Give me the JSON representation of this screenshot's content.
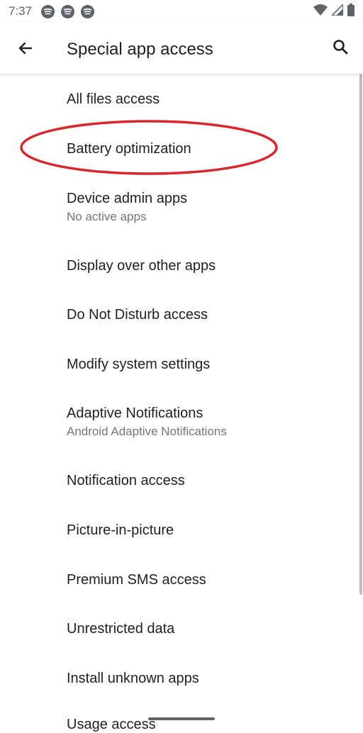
{
  "status_bar": {
    "time": "7:37",
    "notification_icons": [
      "spotify-icon",
      "spotify-icon",
      "spotify-icon"
    ],
    "system_icons": [
      "wifi-icon",
      "signal-icon",
      "battery-icon"
    ]
  },
  "app_bar": {
    "title": "Special app access",
    "back_icon": "arrow-back-icon",
    "search_icon": "search-icon"
  },
  "items": [
    {
      "title": "All files access",
      "summary": ""
    },
    {
      "title": "Battery optimization",
      "summary": ""
    },
    {
      "title": "Device admin apps",
      "summary": "No active apps"
    },
    {
      "title": "Display over other apps",
      "summary": ""
    },
    {
      "title": "Do Not Disturb access",
      "summary": ""
    },
    {
      "title": "Modify system settings",
      "summary": ""
    },
    {
      "title": "Adaptive Notifications",
      "summary": "Android Adaptive Notifications"
    },
    {
      "title": "Notification access",
      "summary": ""
    },
    {
      "title": "Picture-in-picture",
      "summary": ""
    },
    {
      "title": "Premium SMS access",
      "summary": ""
    },
    {
      "title": "Unrestricted data",
      "summary": ""
    },
    {
      "title": "Install unknown apps",
      "summary": ""
    },
    {
      "title": "Usage access",
      "summary": ""
    }
  ],
  "colors": {
    "highlight": "#d9252d",
    "text_primary": "#202124",
    "text_secondary": "#757575"
  }
}
